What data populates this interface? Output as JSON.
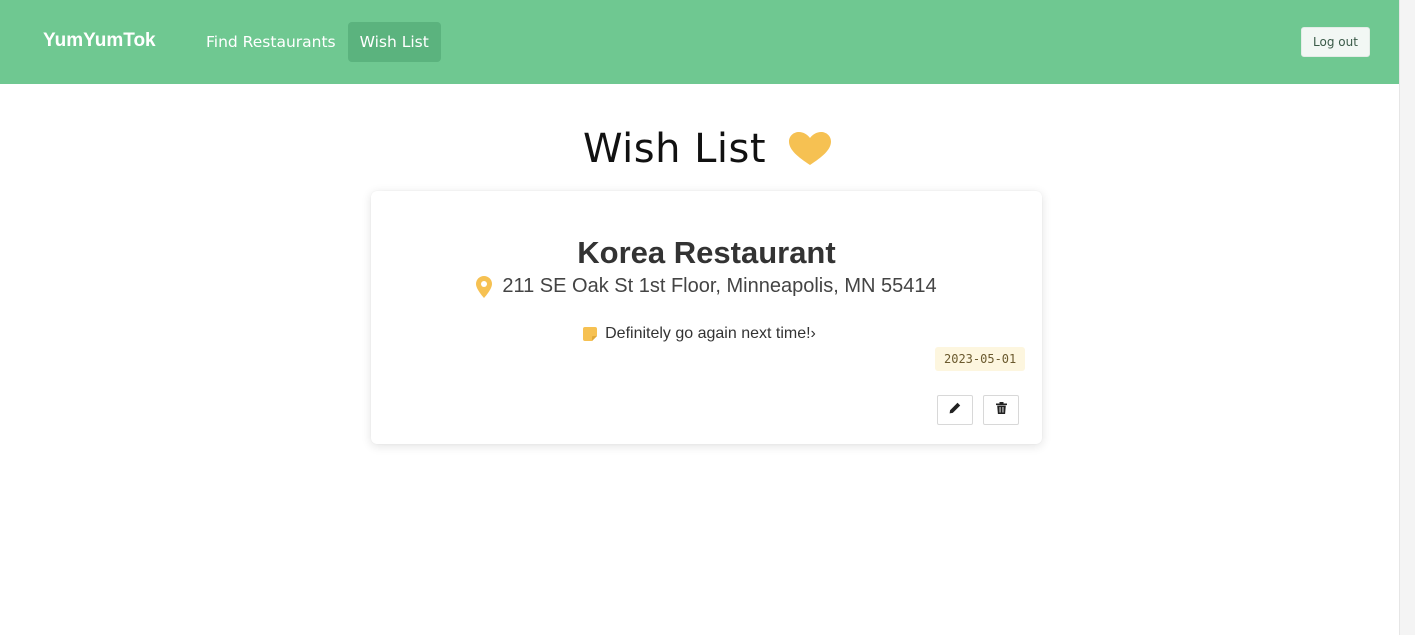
{
  "nav": {
    "brand": "YumYumTok",
    "links": [
      {
        "label": "Find Restaurants",
        "active": false
      },
      {
        "label": "Wish List",
        "active": true
      }
    ],
    "logout_label": "Log out"
  },
  "page": {
    "title": "Wish List",
    "title_icon": "heart-icon"
  },
  "card": {
    "name": "Korea Restaurant",
    "address_icon": "map-pin-icon",
    "address": "211 SE Oak St 1st Floor, Minneapolis, MN 55414",
    "memo_icon": "sticky-note-icon",
    "memo": "Definitely go again next time!›",
    "date": "2023-05-01",
    "edit_icon": "pencil-icon",
    "delete_icon": "trash-icon"
  },
  "colors": {
    "navbar": "#6fc891",
    "nav_active": "#5bb37e",
    "accent_yellow": "#f6c152"
  }
}
